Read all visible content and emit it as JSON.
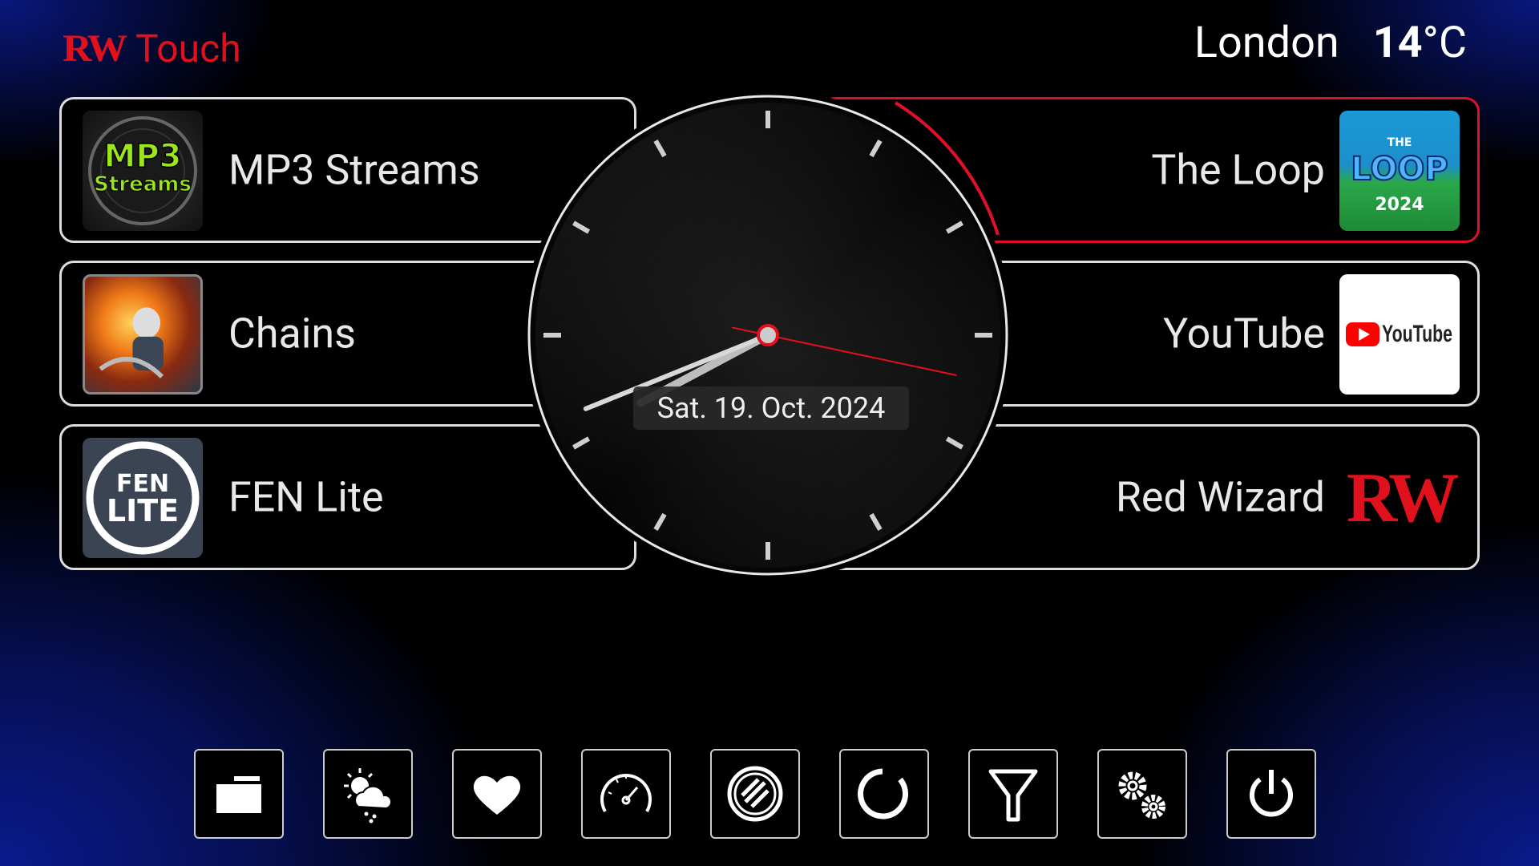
{
  "header": {
    "brand_logo": "RW",
    "brand_title": "Touch",
    "city": "London",
    "temperature": "14",
    "temperature_unit": "°C"
  },
  "left_tiles": [
    {
      "label": "MP3 Streams",
      "icon": "mp3-streams-thumbnail"
    },
    {
      "label": "Chains",
      "icon": "chains-thumbnail"
    },
    {
      "label": "FEN Lite",
      "icon": "fen-lite-thumbnail",
      "logo_line1": "FEN",
      "logo_line2": "LITE"
    }
  ],
  "right_tiles": [
    {
      "label": "The Loop",
      "icon": "the-loop-thumbnail",
      "logo_top": "THE",
      "logo_mid": "LOOP",
      "logo_year": "2024",
      "selected": true
    },
    {
      "label": "YouTube",
      "icon": "youtube-thumbnail",
      "logo_text": "YouTube"
    },
    {
      "label": "Red Wizard",
      "icon": "red-wizard-logo",
      "logo_text": "RW"
    }
  ],
  "clock": {
    "date": "Sat. 19. Oct. 2024",
    "hour_angle_deg": 242,
    "minute_angle_deg": 248,
    "second_angle_deg": 102
  },
  "toolbar": [
    {
      "name": "folder-button",
      "icon": "folder-icon"
    },
    {
      "name": "weather-button",
      "icon": "weather-icon"
    },
    {
      "name": "favourites-button",
      "icon": "heart-icon"
    },
    {
      "name": "speedtest-button",
      "icon": "gauge-icon"
    },
    {
      "name": "trakt-button",
      "icon": "trakt-icon"
    },
    {
      "name": "refresh-button",
      "icon": "refresh-circle-icon"
    },
    {
      "name": "filter-button",
      "icon": "filter-icon"
    },
    {
      "name": "settings-button",
      "icon": "gears-icon"
    },
    {
      "name": "power-button",
      "icon": "power-icon"
    }
  ],
  "colors": {
    "accent_red": "#e0101c",
    "tile_border": "#dddddd",
    "background": "#000000",
    "glow_blue": "#0a1a8c"
  }
}
